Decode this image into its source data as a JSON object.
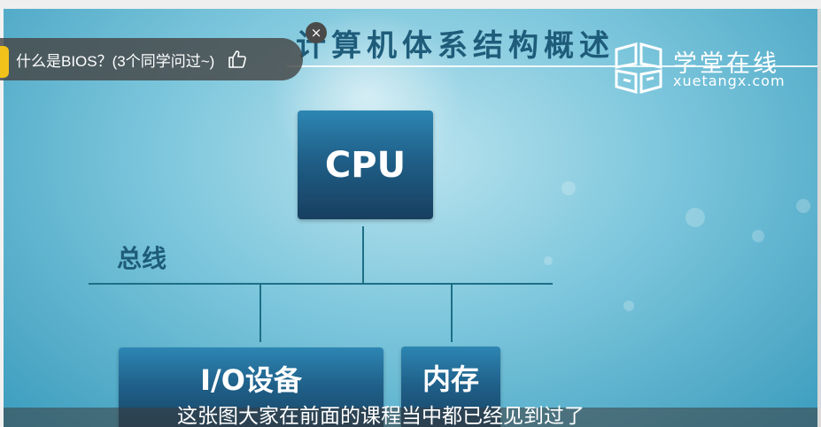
{
  "slide": {
    "title": "计算机体系结构概述",
    "logo": {
      "cn": "学堂在线",
      "en": "xuetangx.com"
    },
    "diagram": {
      "cpu_label": "CPU",
      "bus_label": "总线",
      "io_label": "I/O设备",
      "memory_label": "内存"
    },
    "subtitle": "这张图大家在前面的课程当中都已经见到过了"
  },
  "question_bubble": {
    "text": "什么是BIOS？(3个同学问过~)",
    "close_symbol": "×"
  },
  "colors": {
    "title": "#1e5c7a",
    "box_top": "#2d86b3",
    "box_bottom": "#173f5f",
    "line": "#1d6f86",
    "bubble_bg": "#464646"
  },
  "icons": [
    "close-icon",
    "thumbs-up-icon",
    "xuetangx-logo-icon"
  ]
}
